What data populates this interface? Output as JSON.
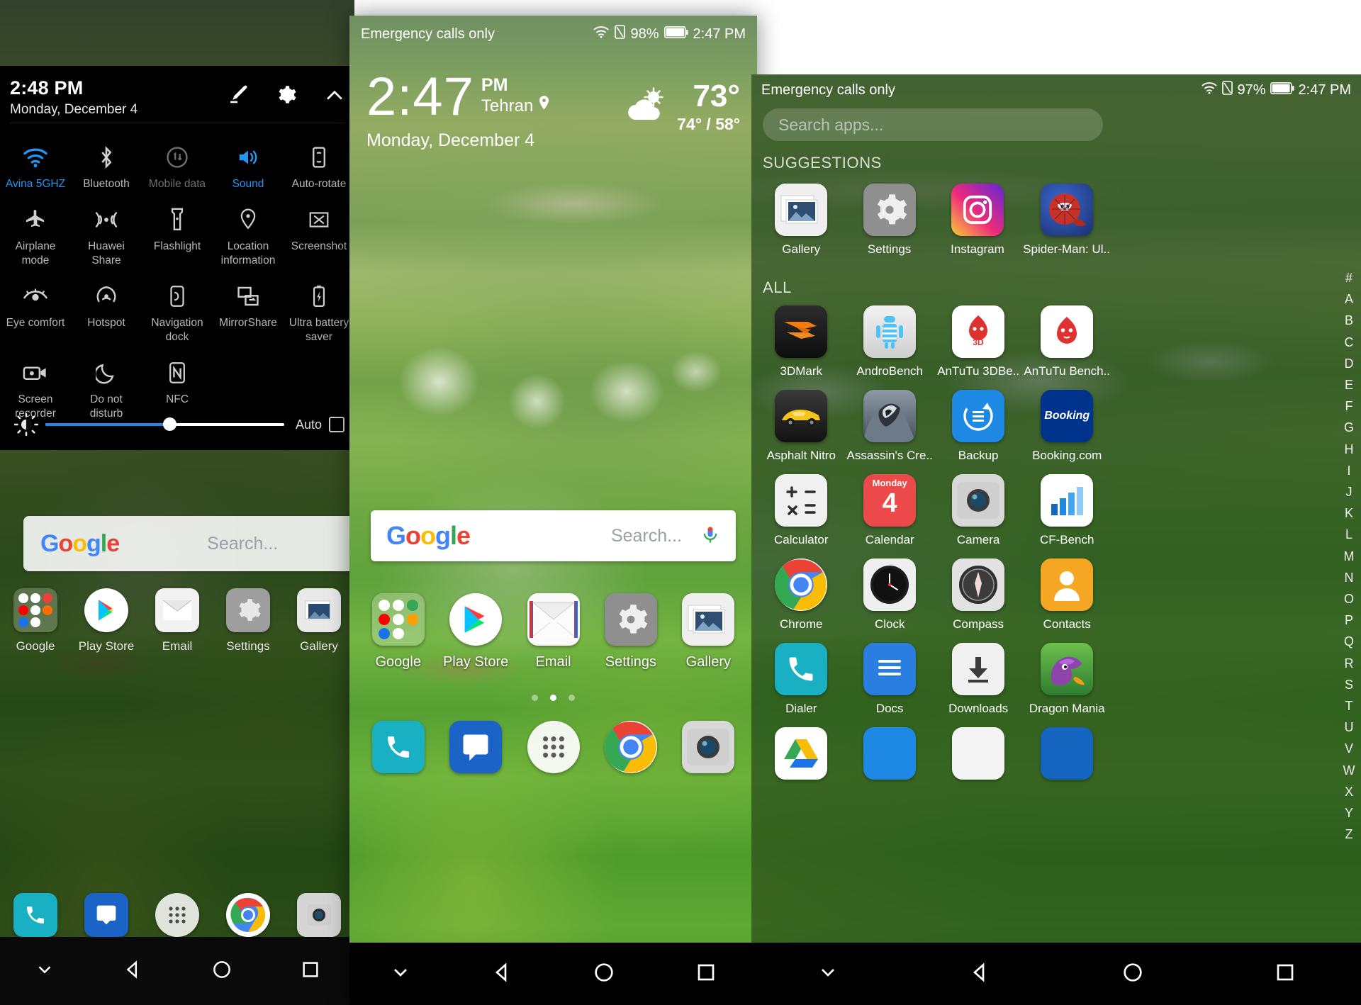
{
  "quick_settings": {
    "time": "2:48 PM",
    "date": "Monday, December 4",
    "edit_icon": "pencil-icon",
    "settings_icon": "gear-icon",
    "collapse_icon": "chevron-up-icon",
    "toggles": [
      {
        "label": "Avina 5GHZ",
        "icon": "wifi-icon",
        "state": "on"
      },
      {
        "label": "Bluetooth",
        "icon": "bluetooth-icon",
        "state": "off"
      },
      {
        "label": "Mobile data",
        "icon": "mobile-data-icon",
        "state": "disabled"
      },
      {
        "label": "Sound",
        "icon": "sound-icon",
        "state": "on"
      },
      {
        "label": "Auto-rotate",
        "icon": "auto-rotate-icon",
        "state": "off"
      },
      {
        "label": "Airplane mode",
        "icon": "airplane-icon",
        "state": "off"
      },
      {
        "label": "Huawei Share",
        "icon": "huawei-share-icon",
        "state": "off"
      },
      {
        "label": "Flashlight",
        "icon": "flashlight-icon",
        "state": "off"
      },
      {
        "label": "Location information",
        "icon": "location-pin-icon",
        "state": "off"
      },
      {
        "label": "Screenshot",
        "icon": "screenshot-icon",
        "state": "off"
      },
      {
        "label": "Eye comfort",
        "icon": "eye-icon",
        "state": "off"
      },
      {
        "label": "Hotspot",
        "icon": "hotspot-icon",
        "state": "off"
      },
      {
        "label": "Navigation dock",
        "icon": "navigation-dock-icon",
        "state": "off"
      },
      {
        "label": "MirrorShare",
        "icon": "mirrorshare-icon",
        "state": "off"
      },
      {
        "label": "Ultra battery saver",
        "icon": "battery-saver-icon",
        "state": "off"
      },
      {
        "label": "Screen recorder",
        "icon": "screen-recorder-icon",
        "state": "off"
      },
      {
        "label": "Do not disturb",
        "icon": "moon-icon",
        "state": "off"
      },
      {
        "label": "NFC",
        "icon": "nfc-icon",
        "state": "off"
      }
    ],
    "brightness": {
      "icon": "brightness-icon",
      "value_percent": 52,
      "auto_label": "Auto",
      "auto_checked": false
    },
    "home_behind": {
      "search_placeholder": "Search...",
      "google_logo": "google-logo",
      "mic_icon": "microphone-icon",
      "apps": [
        "Google",
        "Play Store",
        "Email",
        "Settings",
        "Gallery"
      ],
      "dock": [
        "phone-icon",
        "messages-icon",
        "app-drawer-icon",
        "chrome-icon",
        "camera-icon"
      ],
      "nav": [
        "hide-navbar-icon",
        "back-icon",
        "home-icon",
        "recents-icon"
      ]
    }
  },
  "home_screen": {
    "status_bar": {
      "carrier": "Emergency calls only",
      "wifi_icon": "wifi-icon",
      "sim_icon": "no-sim-icon",
      "battery_percent": "98%",
      "battery_icon": "battery-icon",
      "time": "2:47 PM"
    },
    "clock_widget": {
      "time": "2:47",
      "meridiem": "PM",
      "city": "Tehran",
      "location_icon": "location-pin-icon",
      "date": "Monday, December 4"
    },
    "weather": {
      "icon": "partly-cloudy-icon",
      "temperature": "73°",
      "range": "74° / 58°"
    },
    "search": {
      "google_logo": "google-logo",
      "placeholder": "Search...",
      "mic_icon": "microphone-icon"
    },
    "apps": [
      {
        "label": "Google",
        "icon": "google-folder-icon"
      },
      {
        "label": "Play Store",
        "icon": "play-store-icon"
      },
      {
        "label": "Email",
        "icon": "email-icon"
      },
      {
        "label": "Settings",
        "icon": "settings-gear-icon"
      },
      {
        "label": "Gallery",
        "icon": "gallery-icon"
      }
    ],
    "page_dots": {
      "count": 3,
      "active_index": 1
    },
    "dock": [
      {
        "icon": "phone-icon"
      },
      {
        "icon": "messages-icon"
      },
      {
        "icon": "app-drawer-icon"
      },
      {
        "icon": "chrome-icon"
      },
      {
        "icon": "camera-icon"
      }
    ],
    "nav_bar": [
      "hide-navbar-icon",
      "back-icon",
      "home-icon",
      "recents-icon"
    ]
  },
  "app_drawer": {
    "status_bar": {
      "carrier": "Emergency calls only",
      "wifi_icon": "wifi-icon",
      "sim_icon": "no-sim-icon",
      "battery_percent": "97%",
      "battery_icon": "battery-icon",
      "time": "2:47 PM"
    },
    "search_placeholder": "Search apps...",
    "sections": [
      {
        "title": "SUGGESTIONS",
        "apps": [
          {
            "label": "Gallery",
            "icon": "gallery-icon"
          },
          {
            "label": "Settings",
            "icon": "settings-gear-icon"
          },
          {
            "label": "Instagram",
            "icon": "instagram-icon"
          },
          {
            "label": "Spider-Man: Ul..",
            "icon": "spiderman-icon"
          }
        ]
      },
      {
        "title": "ALL",
        "apps": [
          {
            "label": "3DMark",
            "icon": "3dmark-icon"
          },
          {
            "label": "AndroBench",
            "icon": "androbench-icon"
          },
          {
            "label": "AnTuTu 3DBe..",
            "icon": "antutu-3d-icon"
          },
          {
            "label": "AnTuTu Bench..",
            "icon": "antutu-icon"
          },
          {
            "label": "Asphalt Nitro",
            "icon": "asphalt-nitro-icon"
          },
          {
            "label": "Assassin's Cre..",
            "icon": "assassins-creed-icon"
          },
          {
            "label": "Backup",
            "icon": "backup-icon"
          },
          {
            "label": "Booking.com",
            "icon": "booking-icon"
          },
          {
            "label": "Calculator",
            "icon": "calculator-icon"
          },
          {
            "label": "Calendar",
            "icon": "calendar-icon"
          },
          {
            "label": "Camera",
            "icon": "camera-icon"
          },
          {
            "label": "CF-Bench",
            "icon": "cf-bench-icon"
          },
          {
            "label": "Chrome",
            "icon": "chrome-icon"
          },
          {
            "label": "Clock",
            "icon": "clock-icon"
          },
          {
            "label": "Compass",
            "icon": "compass-icon"
          },
          {
            "label": "Contacts",
            "icon": "contacts-icon"
          },
          {
            "label": "Dialer",
            "icon": "phone-icon"
          },
          {
            "label": "Docs",
            "icon": "docs-icon"
          },
          {
            "label": "Downloads",
            "icon": "downloads-icon"
          },
          {
            "label": "Dragon Mania",
            "icon": "dragon-mania-icon"
          }
        ]
      }
    ],
    "calendar_icon_text": {
      "weekday": "Monday",
      "day": "4"
    },
    "booking_icon_text": "Booking",
    "alphabet_index": [
      "#",
      "A",
      "B",
      "C",
      "D",
      "E",
      "F",
      "G",
      "H",
      "I",
      "J",
      "K",
      "L",
      "M",
      "N",
      "O",
      "P",
      "Q",
      "R",
      "S",
      "T",
      "U",
      "V",
      "W",
      "X",
      "Y",
      "Z"
    ],
    "nav_bar": [
      "hide-navbar-icon",
      "back-icon",
      "home-icon",
      "recents-icon"
    ]
  },
  "colors": {
    "accent_blue": "#2196f3",
    "panel_black": "#000000",
    "drawer_green": "#3d6b33"
  }
}
